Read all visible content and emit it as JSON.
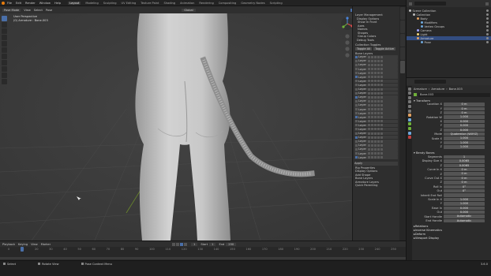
{
  "menu": {
    "items": [
      "File",
      "Edit",
      "Render",
      "Window",
      "Help"
    ],
    "workspaces": [
      "Layout",
      "Modeling",
      "Sculpting",
      "UV Editing",
      "Texture Paint",
      "Shading",
      "Animation",
      "Rendering",
      "Compositing",
      "Geometry Nodes",
      "Scripting"
    ],
    "active_workspace": "Layout",
    "scene": "Scene",
    "view_layer": "ViewLayer"
  },
  "viewport": {
    "header": [
      "Pose Mode",
      "View",
      "Select",
      "Pose"
    ],
    "orientation": "Global",
    "info_line1": "User Perspective",
    "info_line2": "(0) Armature : Bone.003"
  },
  "npanel": {
    "sections": [
      "Layer Management",
      "Display Options"
    ],
    "options": [
      "Show In Front",
      "Axes",
      "Names",
      "Shapes",
      "Group Colors"
    ],
    "debug": "Debug Tools",
    "toggles_title": "Collection Toggles",
    "toggle_buttons": [
      "Toggle All",
      "Toggle Active"
    ],
    "bone_title": "Bone Layers",
    "bone_rows": [
      "Layer",
      "Layer",
      "Layer",
      "Layer",
      "Layer",
      "Layer",
      "Layer",
      "Layer",
      "Layer",
      "Layer",
      "Layer",
      "Layer",
      "Layer",
      "Layer",
      "Layer",
      "Layer",
      "Layer",
      "Layer",
      "Layer",
      "Layer",
      "Layer",
      "Layer",
      "Layer",
      "Layer",
      "Layer",
      "Layer"
    ],
    "lower": [
      "Apply",
      "Rig Properties",
      "Display Options",
      "Add Shape",
      "Bone Layers",
      "Armature Layers",
      "Quick Parenting"
    ],
    "tabs": [
      "Item",
      "Tool",
      "View",
      "Edit",
      "Animation"
    ]
  },
  "outliner": {
    "search_placeholder": "",
    "display_mode": "View Layer",
    "rows": [
      {
        "label": "Scene Collection",
        "color": "#bbbbbb",
        "indent": 0,
        "sel": false
      },
      {
        "label": "Collection",
        "color": "#bbbbbb",
        "indent": 1,
        "sel": false
      },
      {
        "label": "Body",
        "color": "#e0a060",
        "indent": 2,
        "sel": false
      },
      {
        "label": "Modifiers",
        "color": "#6fa8dc",
        "indent": 3,
        "sel": false
      },
      {
        "label": "Vertex Groups",
        "color": "#6fa8dc",
        "indent": 3,
        "sel": false
      },
      {
        "label": "Camera",
        "color": "#9ea2ff",
        "indent": 2,
        "sel": false
      },
      {
        "label": "Light",
        "color": "#f5d77a",
        "indent": 2,
        "sel": false
      },
      {
        "label": "Armature",
        "color": "#e0a060",
        "indent": 2,
        "sel": true
      },
      {
        "label": "Pose",
        "color": "#6fa8dc",
        "indent": 3,
        "sel": false
      }
    ]
  },
  "properties": {
    "breadcrumb": [
      "Armature",
      "Armature",
      "Bone.003"
    ],
    "bone_name": "Bone.003",
    "transform_title": "Transform",
    "transform": [
      {
        "label": "Location X",
        "value": "0 m"
      },
      {
        "label": "Y",
        "value": "0 m"
      },
      {
        "label": "Z",
        "value": "0 m"
      },
      {
        "label": "Rotation W",
        "value": "1.000"
      },
      {
        "label": "X",
        "value": "0.000"
      },
      {
        "label": "Y",
        "value": "0.000"
      },
      {
        "label": "Z",
        "value": "0.000"
      },
      {
        "label": "Mode",
        "value": "Quaternion (WXYZ)"
      },
      {
        "label": "Scale X",
        "value": "1.000"
      },
      {
        "label": "Y",
        "value": "1.000"
      },
      {
        "label": "Z",
        "value": "1.000"
      }
    ],
    "bendy_title": "Bendy Bones",
    "bendy": [
      {
        "label": "Segments",
        "value": "1"
      },
      {
        "label": "Display Size X",
        "value": "0.0065"
      },
      {
        "label": "Z",
        "value": "0.0065"
      },
      {
        "label": "Curve In X",
        "value": "0 m"
      },
      {
        "label": "Z",
        "value": "0 m"
      },
      {
        "label": "Curve Out X",
        "value": "0 m"
      },
      {
        "label": "Z",
        "value": "0 m"
      },
      {
        "label": "Roll In",
        "value": "0°"
      },
      {
        "label": "Out",
        "value": "0°"
      },
      {
        "label": "Inherit End Roll",
        "value": ""
      },
      {
        "label": "Scale In X",
        "value": "1.000"
      },
      {
        "label": "Y",
        "value": "1.000"
      },
      {
        "label": "Ease In",
        "value": "0.000"
      },
      {
        "label": "Out",
        "value": "0.000"
      },
      {
        "label": "Start Handle",
        "value": "Automatic"
      },
      {
        "label": "End Handle",
        "value": "Automatic"
      }
    ],
    "collapsed": [
      "Relations",
      "Inverse Kinematics",
      "Deform",
      "Viewport Display"
    ]
  },
  "timeline": {
    "menu": [
      "Playback",
      "Keying",
      "View",
      "Marker"
    ],
    "current_frame": "1",
    "start_label": "Start",
    "start": "1",
    "end_label": "End",
    "end": "250",
    "ticks": [
      "0",
      "10",
      "20",
      "30",
      "40",
      "50",
      "60",
      "70",
      "80",
      "90",
      "100",
      "110",
      "120",
      "130",
      "140",
      "150",
      "160",
      "170",
      "180",
      "190",
      "200",
      "210",
      "220",
      "230",
      "240",
      "250"
    ]
  },
  "status": {
    "left": [
      "Select",
      "Rotate View",
      "Pose Context Menu"
    ],
    "version": "3.6.0"
  },
  "colors": {
    "accent": "#4a6fa8",
    "viewport_bg": "#3a3a3a",
    "body": "#c4c4c4",
    "grid_x": "#8b3a3a",
    "grid_y": "#6b8a2a"
  }
}
